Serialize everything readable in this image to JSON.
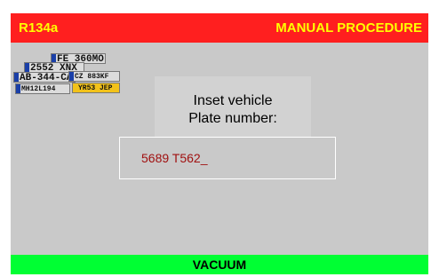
{
  "header": {
    "left_label": "R134a",
    "right_label": "MANUAL PROCEDURE"
  },
  "plates_image": {
    "icon": "license-plates-icon",
    "plates": [
      "FE 360MO",
      "2552 XNX",
      "AB-344-CA",
      "CZ 883KF",
      "YR53 JEP",
      "MH12L194"
    ]
  },
  "prompt": {
    "line1": "Inset vehicle",
    "line2": "Plate number:"
  },
  "plate_input": {
    "value": "5689 T562_"
  },
  "footer": {
    "label": "VACUUM"
  },
  "colors": {
    "header_bg": "#ff1f1f",
    "header_text": "#ffff00",
    "content_bg": "#c9c9c9",
    "footer_bg": "#00ff33",
    "input_text": "#a01010"
  }
}
